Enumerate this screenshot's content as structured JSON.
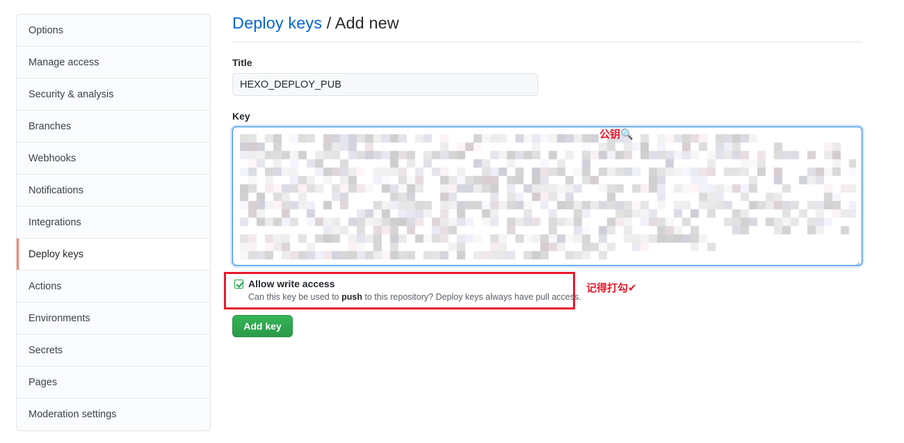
{
  "sidebar": {
    "items": [
      {
        "label": "Options",
        "selected": false
      },
      {
        "label": "Manage access",
        "selected": false
      },
      {
        "label": "Security & analysis",
        "selected": false
      },
      {
        "label": "Branches",
        "selected": false
      },
      {
        "label": "Webhooks",
        "selected": false
      },
      {
        "label": "Notifications",
        "selected": false
      },
      {
        "label": "Integrations",
        "selected": false
      },
      {
        "label": "Deploy keys",
        "selected": true
      },
      {
        "label": "Actions",
        "selected": false
      },
      {
        "label": "Environments",
        "selected": false
      },
      {
        "label": "Secrets",
        "selected": false
      },
      {
        "label": "Pages",
        "selected": false
      },
      {
        "label": "Moderation settings",
        "selected": false
      }
    ]
  },
  "header": {
    "breadcrumb_link": "Deploy keys",
    "breadcrumb_separator": " / ",
    "breadcrumb_current": "Add new"
  },
  "form": {
    "title_label": "Title",
    "title_value": "HEXO_DEPLOY_PUB",
    "title_placeholder": "",
    "key_label": "Key",
    "key_value": "",
    "key_placeholder": "",
    "allow_write_label": "Allow write access",
    "allow_write_checked": true,
    "allow_write_help_before": "Can this key be used to ",
    "allow_write_help_bold": "push",
    "allow_write_help_after": " to this repository? Deploy keys always have pull access.",
    "submit_label": "Add key"
  },
  "annotations": [
    {
      "id": "public-key",
      "text": "公钥",
      "glyph": "🔍",
      "color": "#e8192c"
    },
    {
      "id": "remember-tick",
      "text": "记得打勾",
      "glyph": "✔",
      "color": "#e8192c"
    }
  ],
  "colors": {
    "link": "#0366d6",
    "selected_marker": "#f9826c",
    "focus_border": "#2188ff",
    "annotation_red": "#e8192c",
    "button_green": "#2ea44f",
    "checkbox_green": "#1f9d44"
  }
}
